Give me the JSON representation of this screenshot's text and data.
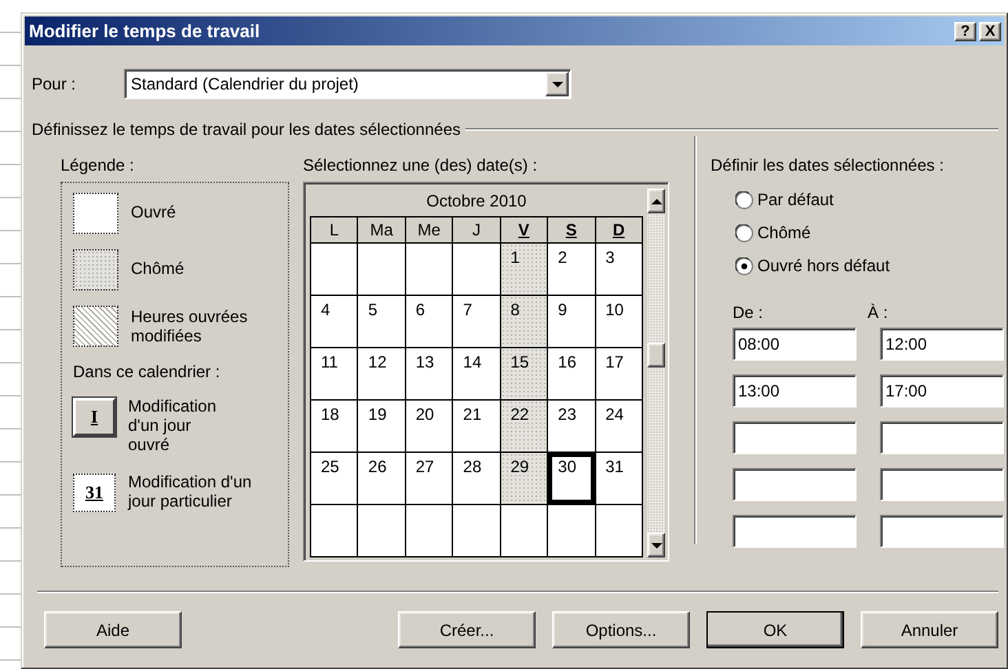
{
  "window": {
    "title": "Modifier le temps de travail",
    "help": "?",
    "close": "X"
  },
  "pour": {
    "label": "Pour :",
    "value": "Standard (Calendrier du projet)"
  },
  "group_title": "Définissez le temps de travail pour les dates sélectionnées",
  "legend": {
    "title": "Légende :",
    "items": [
      {
        "kind": "working",
        "label": "Ouvré"
      },
      {
        "kind": "nonworking",
        "label": "Chômé"
      },
      {
        "kind": "edited",
        "label": "Heures ouvrées\nmodifiées"
      }
    ],
    "subtitle": "Dans ce calendrier :",
    "markers": [
      {
        "kind": "weekday",
        "glyph": "I",
        "label": "Modification\nd'un jour\nouvré"
      },
      {
        "kind": "date",
        "glyph": "31",
        "label": "Modification d'un\njour particulier"
      }
    ]
  },
  "calendar": {
    "label": "Sélectionnez une (des) date(s) :",
    "month": "Octobre 2010",
    "weekdays": [
      {
        "label": "L",
        "edited": false
      },
      {
        "label": "Ma",
        "edited": false
      },
      {
        "label": "Me",
        "edited": false
      },
      {
        "label": "J",
        "edited": false
      },
      {
        "label": "V",
        "edited": true
      },
      {
        "label": "S",
        "edited": true
      },
      {
        "label": "D",
        "edited": true
      }
    ],
    "weeks": [
      [
        {
          "kind": "blank"
        },
        {
          "kind": "blank"
        },
        {
          "kind": "blank"
        },
        {
          "kind": "blank"
        },
        {
          "kind": "date",
          "day": "1",
          "nonworking": true,
          "selected": false
        },
        {
          "kind": "date",
          "day": "2",
          "nonworking": false,
          "selected": false
        },
        {
          "kind": "date",
          "day": "3",
          "nonworking": false,
          "selected": false
        }
      ],
      [
        {
          "kind": "date",
          "day": "4",
          "nonworking": false,
          "selected": false
        },
        {
          "kind": "date",
          "day": "5",
          "nonworking": false,
          "selected": false
        },
        {
          "kind": "date",
          "day": "6",
          "nonworking": false,
          "selected": false
        },
        {
          "kind": "date",
          "day": "7",
          "nonworking": false,
          "selected": false
        },
        {
          "kind": "date",
          "day": "8",
          "nonworking": true,
          "selected": false
        },
        {
          "kind": "date",
          "day": "9",
          "nonworking": false,
          "selected": false
        },
        {
          "kind": "date",
          "day": "10",
          "nonworking": false,
          "selected": false
        }
      ],
      [
        {
          "kind": "date",
          "day": "11",
          "nonworking": false,
          "selected": false
        },
        {
          "kind": "date",
          "day": "12",
          "nonworking": false,
          "selected": false
        },
        {
          "kind": "date",
          "day": "13",
          "nonworking": false,
          "selected": false
        },
        {
          "kind": "date",
          "day": "14",
          "nonworking": false,
          "selected": false
        },
        {
          "kind": "date",
          "day": "15",
          "nonworking": true,
          "selected": false
        },
        {
          "kind": "date",
          "day": "16",
          "nonworking": false,
          "selected": false
        },
        {
          "kind": "date",
          "day": "17",
          "nonworking": false,
          "selected": false
        }
      ],
      [
        {
          "kind": "date",
          "day": "18",
          "nonworking": false,
          "selected": false
        },
        {
          "kind": "date",
          "day": "19",
          "nonworking": false,
          "selected": false
        },
        {
          "kind": "date",
          "day": "20",
          "nonworking": false,
          "selected": false
        },
        {
          "kind": "date",
          "day": "21",
          "nonworking": false,
          "selected": false
        },
        {
          "kind": "date",
          "day": "22",
          "nonworking": true,
          "selected": false
        },
        {
          "kind": "date",
          "day": "23",
          "nonworking": false,
          "selected": false
        },
        {
          "kind": "date",
          "day": "24",
          "nonworking": false,
          "selected": false
        }
      ],
      [
        {
          "kind": "date",
          "day": "25",
          "nonworking": false,
          "selected": false
        },
        {
          "kind": "date",
          "day": "26",
          "nonworking": false,
          "selected": false
        },
        {
          "kind": "date",
          "day": "27",
          "nonworking": false,
          "selected": false
        },
        {
          "kind": "date",
          "day": "28",
          "nonworking": false,
          "selected": false
        },
        {
          "kind": "date",
          "day": "29",
          "nonworking": true,
          "selected": false
        },
        {
          "kind": "date",
          "day": "30",
          "nonworking": false,
          "selected": true
        },
        {
          "kind": "date",
          "day": "31",
          "nonworking": false,
          "selected": false
        }
      ],
      [
        {
          "kind": "blank"
        },
        {
          "kind": "blank"
        },
        {
          "kind": "blank"
        },
        {
          "kind": "blank"
        },
        {
          "kind": "blank"
        },
        {
          "kind": "blank"
        },
        {
          "kind": "blank"
        }
      ]
    ]
  },
  "define": {
    "title": "Définir les dates sélectionnées :",
    "options": [
      {
        "label": "Par défaut",
        "selected": false
      },
      {
        "label": "Chômé",
        "selected": false
      },
      {
        "label": "Ouvré hors défaut",
        "selected": true
      }
    ],
    "from_label": "De :",
    "to_label": "À :",
    "times": [
      {
        "kind": "filled",
        "from": "08:00",
        "to": "12:00"
      },
      {
        "kind": "filled",
        "from": "13:00",
        "to": "17:00"
      },
      {
        "kind": "blank"
      },
      {
        "kind": "blank"
      },
      {
        "kind": "blank"
      }
    ]
  },
  "footer": {
    "left": [
      {
        "label": "Aide",
        "default": false
      }
    ],
    "right": [
      {
        "label": "Créer...",
        "default": false
      },
      {
        "label": "Options...",
        "default": false
      },
      {
        "label": "OK",
        "default": true
      },
      {
        "label": "Annuler",
        "default": false
      }
    ]
  }
}
